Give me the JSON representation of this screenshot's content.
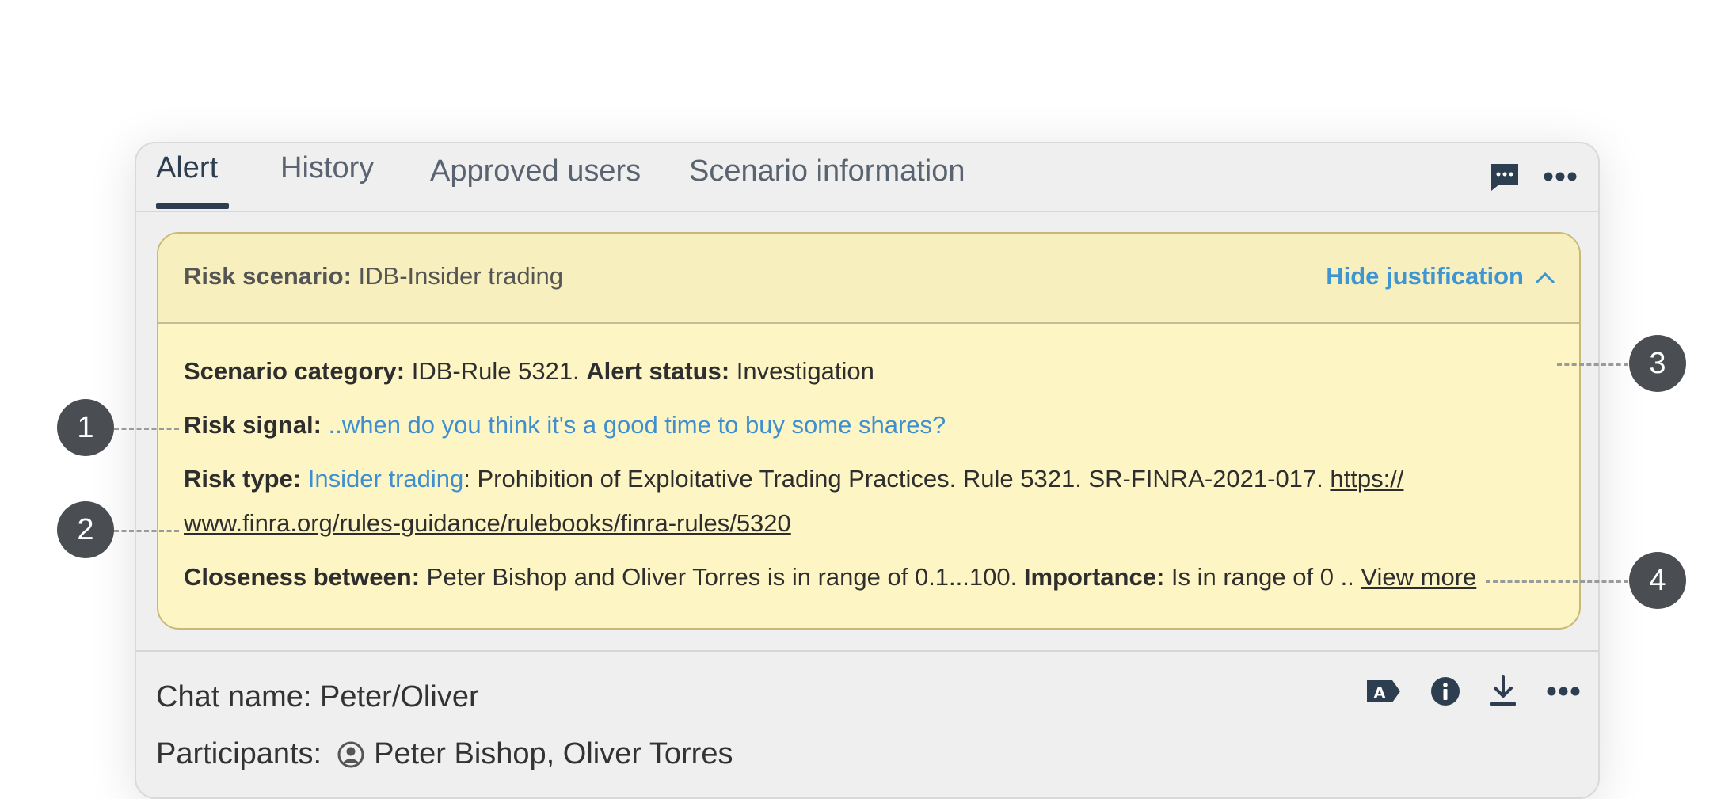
{
  "tabs": [
    {
      "label": "Alert",
      "active": true
    },
    {
      "label": "History",
      "active": false
    },
    {
      "label": "Approved users",
      "active": false
    },
    {
      "label": "Scenario information",
      "active": false
    }
  ],
  "tab_icons": [
    "chat-icon",
    "more-horizontal-icon"
  ],
  "alert": {
    "risk_scenario_label": "Risk scenario:",
    "risk_scenario_value": " IDB-Insider trading",
    "hide_justification": "Hide justification",
    "scenario_category_label": "Scenario category:",
    "scenario_category_value": " IDB-Rule 5321. ",
    "alert_status_label": "Alert status:",
    "alert_status_value": " Investigation",
    "risk_signal_label": "Risk signal:",
    "risk_signal_value": " ..when do you think it's a good time to buy some shares?",
    "risk_type_label": "Risk type:",
    "risk_type_link": "Insider trading",
    "risk_type_text": ": Prohibition of Exploitative Trading Practices. Rule 5321. SR-FINRA-2021-017. ",
    "risk_type_url_part1": "https://",
    "risk_type_url_part2": "www.finra.org/rules-guidance/rulebooks/finra-rules/5320",
    "closeness_label": "Closeness between:",
    "closeness_value": " Peter Bishop and Oliver Torres is in range of 0.1...100. ",
    "importance_label": "Importance:",
    "importance_value": " Is in range of 0 .. ",
    "view_more": "View more"
  },
  "chat": {
    "name": "Chat name: Peter/Oliver",
    "participants_label": "Participants:",
    "participants_value": "Peter Bishop, Oliver Torres",
    "icons": [
      "label-a-icon",
      "info-icon",
      "download-icon",
      "more-horizontal-icon"
    ]
  },
  "callouts": [
    "1",
    "2",
    "3",
    "4"
  ],
  "colors": {
    "accent_blue": "#3d95d3",
    "dark_navy": "#2c3e50",
    "alert_bg": "#fdf5c4",
    "callout_bg": "#4a4d52"
  }
}
